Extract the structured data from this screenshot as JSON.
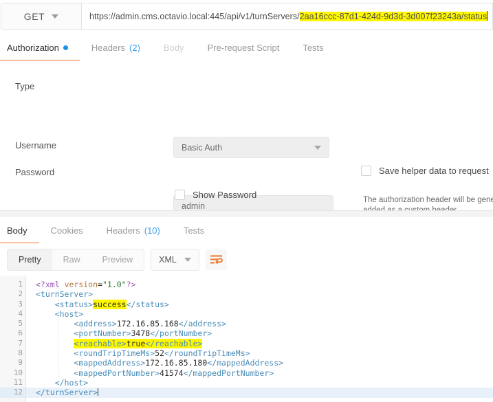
{
  "request_bar": {
    "method": "GET",
    "method_caret_icon": "chevron-down-icon",
    "url_prefix": "https://admin.cms.octavio.local:445/api/v1/turnServers/",
    "url_highlighted": "2aa16ccc-87d1-424d-9d3d-3d007f23243a/status"
  },
  "request_tabs": [
    {
      "label": "Authorization",
      "active": true,
      "indicator": "blue-dot",
      "count": ""
    },
    {
      "label": "Headers",
      "active": false,
      "indicator": "",
      "count": "(2)"
    },
    {
      "label": "Body",
      "active": false,
      "indicator": "",
      "count": "",
      "disabled": true
    },
    {
      "label": "Pre-request Script",
      "active": false,
      "indicator": "",
      "count": ""
    },
    {
      "label": "Tests",
      "active": false,
      "indicator": "",
      "count": ""
    }
  ],
  "authorization": {
    "type_label": "Type",
    "type_value": "Basic Auth",
    "type_caret_icon": "chevron-down-icon",
    "username_label": "Username",
    "username_value": "admin",
    "password_label": "Password",
    "password_value": "•••••",
    "show_password_label": "Show Password",
    "show_password_checked": false,
    "helper_note_line1": "The authorization header will be generat",
    "helper_note_line2": "added as a custom header",
    "save_helper_label": "Save helper data to request",
    "save_helper_checked": false
  },
  "response_tabs": [
    {
      "label": "Body",
      "active": true,
      "count": ""
    },
    {
      "label": "Cookies",
      "active": false,
      "count": ""
    },
    {
      "label": "Headers",
      "active": false,
      "count": "(10)"
    },
    {
      "label": "Tests",
      "active": false,
      "count": ""
    }
  ],
  "response_toolbar": {
    "view_modes": [
      {
        "label": "Pretty",
        "active": true
      },
      {
        "label": "Raw",
        "active": false
      },
      {
        "label": "Preview",
        "active": false
      }
    ],
    "format": "XML",
    "format_caret_icon": "chevron-down-icon",
    "wrap_icon": "word-wrap-icon"
  },
  "colors": {
    "accent": "#ef7326",
    "link_blue": "#3fa0e8",
    "dot_blue": "#1e8fe1",
    "highlight_yellow": "#fff700",
    "active_line": "#e8f1fa",
    "xml_tag": "#4a8db7"
  },
  "code_view": {
    "language": "XML",
    "line_numbers": [
      "1",
      "2",
      "3",
      "4",
      "5",
      "6",
      "7",
      "8",
      "9",
      "10",
      "11",
      "12"
    ],
    "folded_lines": [
      2,
      4
    ],
    "current_line": 12,
    "lines": [
      {
        "n": 1,
        "text": "<?xml version=\"1.0\"?>"
      },
      {
        "n": 2,
        "text": "<turnServer>"
      },
      {
        "n": 3,
        "text": "    <status>success</status>"
      },
      {
        "n": 4,
        "text": "    <host>"
      },
      {
        "n": 5,
        "text": "        <address>172.16.85.168</address>"
      },
      {
        "n": 6,
        "text": "        <portNumber>3478</portNumber>"
      },
      {
        "n": 7,
        "text": "        <reachable>true</reachable>"
      },
      {
        "n": 8,
        "text": "        <roundTripTimeMs>52</roundTripTimeMs>"
      },
      {
        "n": 9,
        "text": "        <mappedAddress>172.16.85.180</mappedAddress>"
      },
      {
        "n": 10,
        "text": "        <mappedPortNumber>41574</mappedPortNumber>"
      },
      {
        "n": 11,
        "text": "    </host>"
      },
      {
        "n": 12,
        "text": "</turnServer>"
      }
    ],
    "highlighted_text": [
      "success",
      "<reachable>true</reachable>"
    ],
    "values": {
      "status": "success",
      "address": "172.16.85.168",
      "portNumber": "3478",
      "reachable": "true",
      "roundTripTimeMs": "52",
      "mappedAddress": "172.16.85.180",
      "mappedPortNumber": "41574"
    }
  }
}
